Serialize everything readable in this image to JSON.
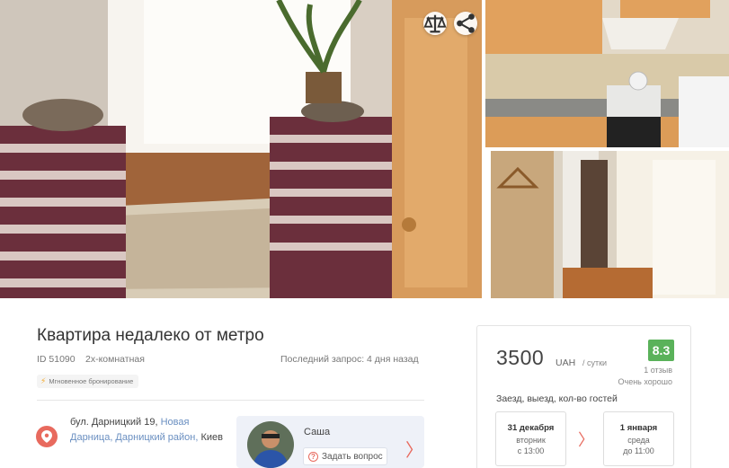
{
  "listing": {
    "title": "Квартира недалеко от метро",
    "id": "ID 51090",
    "rooms": "2х-комнатная",
    "last_request": "Последний запрос: 4 дня назад",
    "instant_badge": "Мгновенное бронирование"
  },
  "gallery": {
    "photos": [
      "bedroom-photo",
      "kitchen-photo",
      "hallway-photo"
    ],
    "compare_icon": "scales-icon",
    "share_icon": "share-icon"
  },
  "address": {
    "street": "бул. Дарницкий 19,",
    "district_link": "Новая Дарница, Дарницкий район,",
    "city": "Киев",
    "icon": "location-pin-icon"
  },
  "host": {
    "name": "Саша",
    "ask_label": "Задать вопрос"
  },
  "booking": {
    "price": "3500",
    "currency": "UAH",
    "per": "/ сутки",
    "rating": "8.3",
    "reviews": "1 отзыв",
    "rating_word": "Очень хорошо",
    "guests_label": "Заезд, выезд, кол-во гостей",
    "check_in": {
      "date": "31 декабря",
      "weekday": "вторник",
      "time": "с 13:00"
    },
    "check_out": {
      "date": "1 января",
      "weekday": "среда",
      "time": "до 11:00"
    }
  },
  "colors": {
    "accent": "#e86a5e",
    "rating_bg": "#5ab25a",
    "link": "#6a8fc1"
  }
}
